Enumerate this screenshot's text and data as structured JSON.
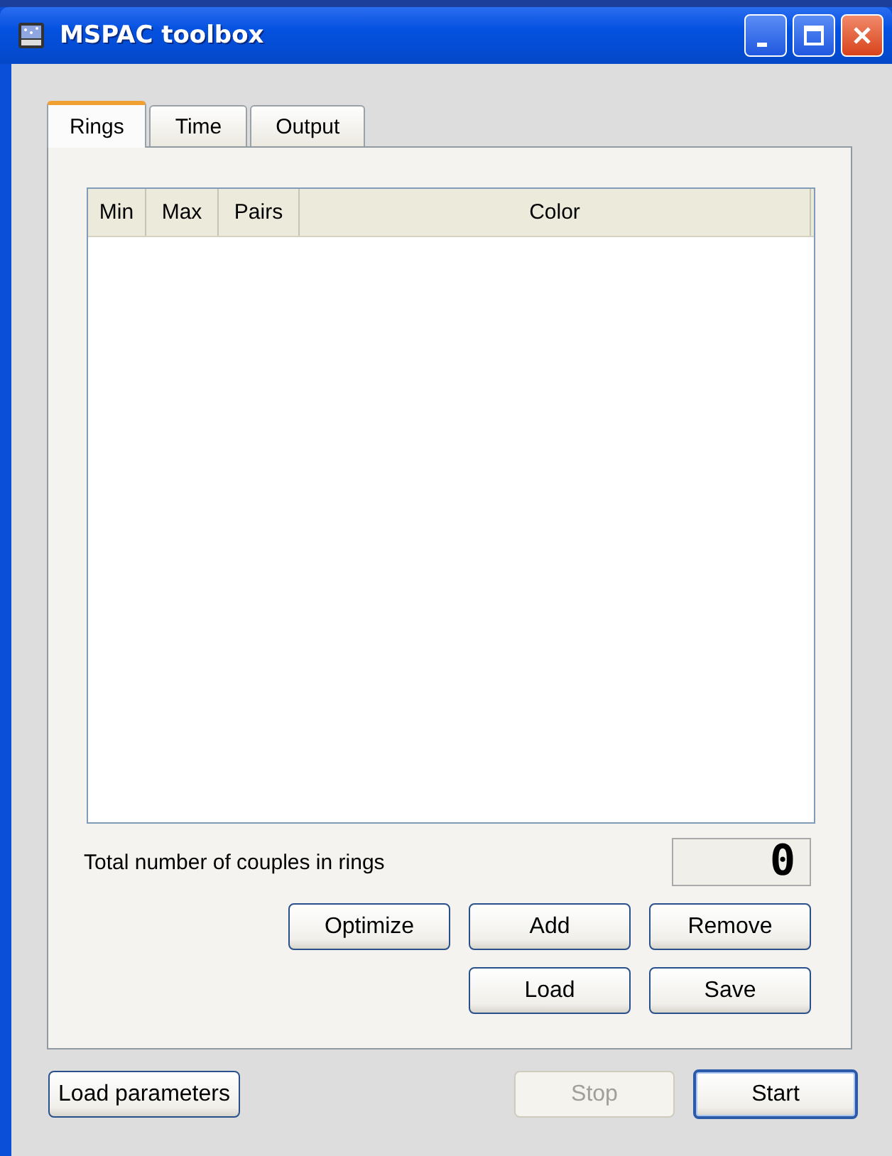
{
  "window": {
    "title": "MSPAC toolbox"
  },
  "tabs": [
    {
      "label": "Rings",
      "selected": true
    },
    {
      "label": "Time",
      "selected": false
    },
    {
      "label": "Output",
      "selected": false
    }
  ],
  "table": {
    "columns": [
      "Min",
      "Max",
      "Pairs",
      "Color"
    ]
  },
  "total": {
    "label": "Total number of couples in rings",
    "value": "0"
  },
  "panel_buttons": [
    [
      {
        "label": "Optimize",
        "disabled": false
      },
      {
        "label": "Add",
        "disabled": false
      },
      {
        "label": "Remove",
        "disabled": false
      }
    ],
    [
      {
        "label": "Load",
        "disabled": false
      },
      {
        "label": "Save",
        "disabled": false
      }
    ]
  ],
  "footer_buttons": [
    {
      "label": "Load parameters",
      "disabled": false,
      "default": false
    },
    {
      "label": "Stop",
      "disabled": true,
      "default": false
    },
    {
      "label": "Start",
      "disabled": false,
      "default": true
    }
  ]
}
